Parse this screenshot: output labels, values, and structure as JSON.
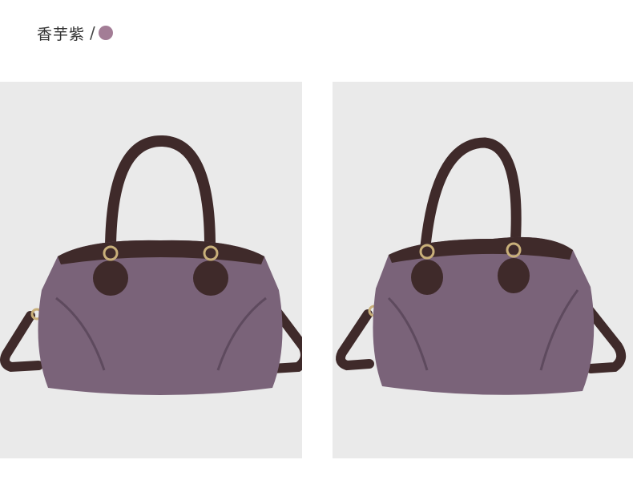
{
  "header": {
    "color_name": "香芋紫",
    "separator": "/",
    "swatch_color": "#a37d96"
  },
  "panels": [
    {
      "subject": "handbag-front-view"
    },
    {
      "subject": "handbag-angled-view"
    }
  ],
  "colors": {
    "leather": "#7a6379",
    "leather_dark": "#5e4a5e",
    "trim": "#3f2a2a",
    "hardware": "#c9b07a",
    "background": "#eaeaea"
  }
}
